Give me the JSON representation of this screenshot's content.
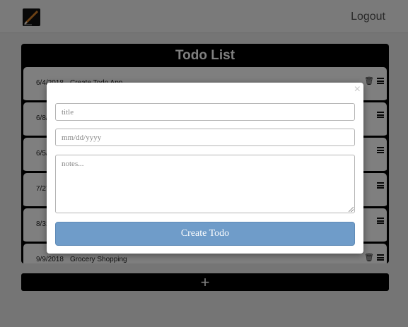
{
  "navbar": {
    "logout_label": "Logout"
  },
  "todo_list": {
    "title": "Todo List",
    "rows": [
      {
        "date": "6/4/2018",
        "text": "Create Todo App"
      },
      {
        "date": "6/8/",
        "text": ""
      },
      {
        "date": "6/5/",
        "text": ""
      },
      {
        "date": "7/27",
        "text": ""
      },
      {
        "date": "8/31",
        "text": ""
      },
      {
        "date": "9/9/2018",
        "text": "Grocery Shopping"
      }
    ],
    "add_label": "+"
  },
  "modal": {
    "close_label": "×",
    "title_placeholder": "title",
    "date_placeholder": "mm/dd/yyyy",
    "notes_placeholder": "notes...",
    "create_label": "Create Todo"
  },
  "colors": {
    "accent": "#6f9cc9",
    "card": "#000000",
    "overlay": "rgba(0,0,0,0.5)"
  },
  "icons": {
    "logo": "pen-icon",
    "row_action": "trash-icon",
    "row_menu": "menu-icon",
    "close": "close-icon"
  }
}
